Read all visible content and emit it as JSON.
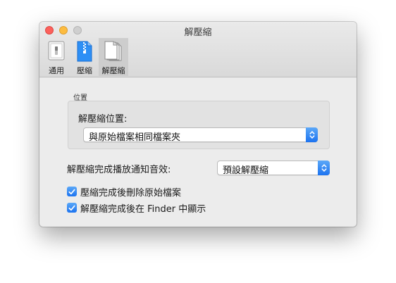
{
  "window": {
    "title": "解壓縮"
  },
  "tabs": [
    {
      "label": "通用",
      "icon": "general-switch-icon",
      "active": false
    },
    {
      "label": "壓縮",
      "icon": "zip-archive-icon",
      "active": false
    },
    {
      "label": "解壓縮",
      "icon": "extract-documents-icon",
      "active": true
    }
  ],
  "location": {
    "section_label": "位置",
    "label": "解壓縮位置:",
    "selected": "與原始檔案相同檔案夾"
  },
  "sound": {
    "label": "解壓縮完成播放通知音效:",
    "selected": "預設解壓縮"
  },
  "options": [
    {
      "label": "壓縮完成後刪除原始檔案",
      "checked": true
    },
    {
      "label": "解壓縮完成後在 Finder 中顯示",
      "checked": true
    }
  ],
  "colors": {
    "accent": "#1c73f0",
    "close": "#fc605c",
    "minimize": "#fdbc40",
    "zoom_disabled": "#cfcfcf"
  }
}
